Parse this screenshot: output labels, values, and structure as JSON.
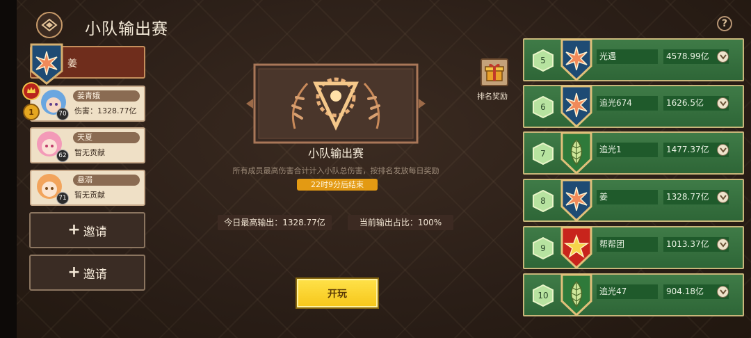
{
  "header": {
    "title": "小队输出赛",
    "help_symbol": "?"
  },
  "team": {
    "name": "姜",
    "members": [
      {
        "name": "姜青娥",
        "stat": "伤害：1328.77亿",
        "level": "70",
        "rank_badge": "1"
      },
      {
        "name": "天夏",
        "stat": "暂无贡献",
        "level": "62"
      },
      {
        "name": "悬溺",
        "stat": "暂无贡献",
        "level": "71"
      }
    ],
    "invite_label": "邀请",
    "invite_plus": "+"
  },
  "event": {
    "title": "小队输出赛",
    "description": "所有成员最高伤害合计计入小队总伤害，按排名发放每日奖励",
    "countdown": "22时9分后结束",
    "today_max": "今日最高输出：1328.77亿",
    "current_ratio": "当前输出占比：100%",
    "play_label": "开玩"
  },
  "reward": {
    "label": "排名奖励"
  },
  "ranking": [
    {
      "rank": "5",
      "name": "光遇",
      "value": "4578.99亿",
      "badge": "star-blue"
    },
    {
      "rank": "6",
      "name": "追光674",
      "value": "1626.5亿",
      "badge": "star-blue"
    },
    {
      "rank": "7",
      "name": "追光1",
      "value": "1477.37亿",
      "badge": "leaf-green"
    },
    {
      "rank": "8",
      "name": "姜",
      "value": "1328.77亿",
      "badge": "star-blue"
    },
    {
      "rank": "9",
      "name": "帮帮团",
      "value": "1013.37亿",
      "badge": "star-red"
    },
    {
      "rank": "10",
      "name": "追光47",
      "value": "904.18亿",
      "badge": "leaf-green"
    }
  ],
  "colors": {
    "accent_yellow": "#f6c619",
    "countdown_orange": "#e39a13",
    "rank_green": "#2e6637",
    "team_red": "#6f2d1c"
  }
}
